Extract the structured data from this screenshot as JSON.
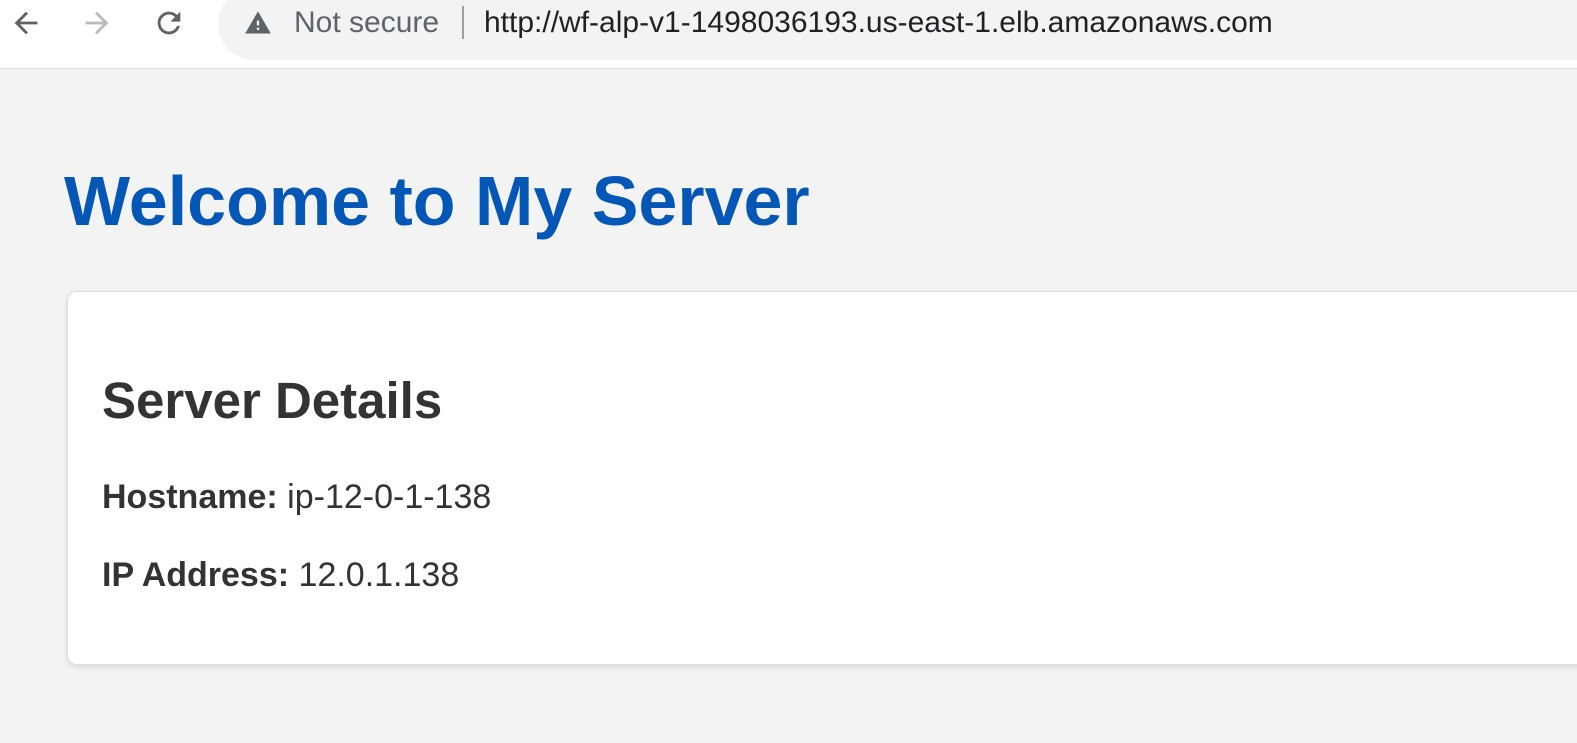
{
  "browser": {
    "back_icon": "arrow-left-icon",
    "forward_icon": "arrow-right-icon",
    "reload_icon": "reload-icon",
    "security_icon": "warning-triangle-icon",
    "security_label": "Not secure",
    "url": "http://wf-alp-v1-1498036193.us-east-1.elb.amazonaws.com"
  },
  "page": {
    "title": "Welcome to My Server",
    "title_color": "#0457b6",
    "background_color": "#f3f3f3"
  },
  "card": {
    "title": "Server Details",
    "rows": [
      {
        "label": "Hostname:",
        "value": "ip-12-0-1-138"
      },
      {
        "label": "IP Address:",
        "value": "12.0.1.138"
      }
    ]
  }
}
